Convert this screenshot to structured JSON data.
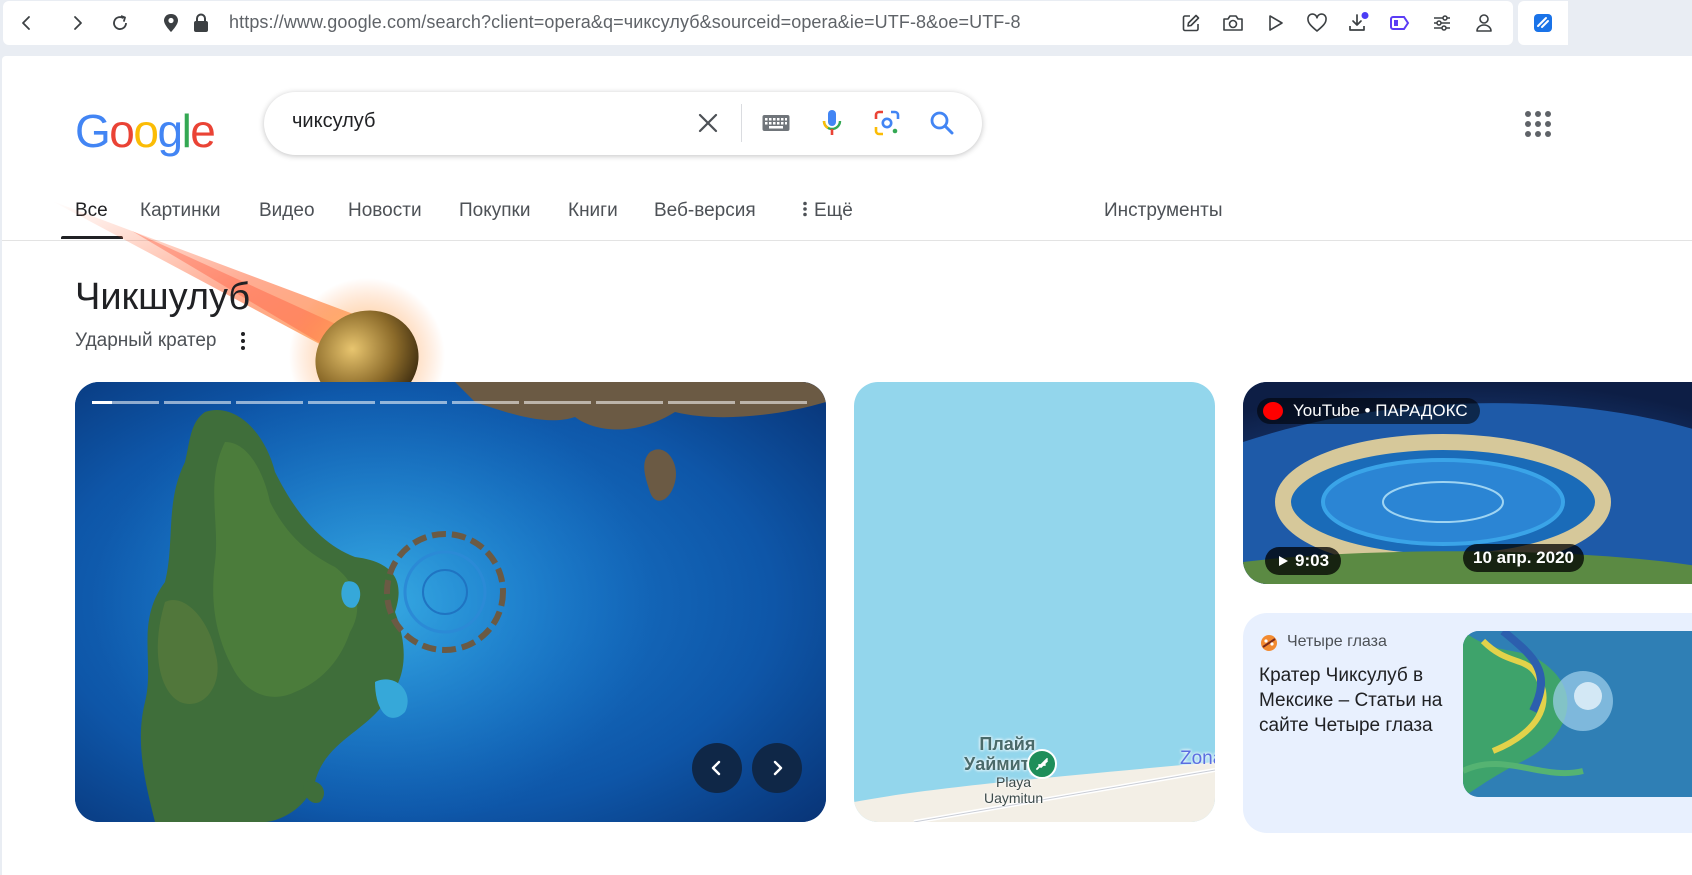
{
  "browser": {
    "url": "https://www.google.com/search?client=opera&q=чиксулуб&sourceid=opera&ie=UTF-8&oe=UTF-8"
  },
  "logo": {
    "letters": [
      "G",
      "o",
      "o",
      "g",
      "l",
      "e"
    ],
    "colors": [
      "#4285F4",
      "#EA4335",
      "#FBBC05",
      "#4285F4",
      "#34A853",
      "#EA4335"
    ]
  },
  "search": {
    "query": "чиксулуб"
  },
  "tabs": {
    "all": "Все",
    "images": "Картинки",
    "video": "Видео",
    "news": "Новости",
    "shopping": "Покупки",
    "books": "Книги",
    "web": "Веб-версия",
    "more": "Ещё",
    "tools": "Инструменты"
  },
  "knowledge_panel": {
    "title": "Чикшулуб",
    "subtitle": "Ударный кратер"
  },
  "map": {
    "place_ru": "Плайя Уаймитун",
    "place_ru_line1": "Плайя",
    "place_ru_line2": "Уаймитун",
    "place_es_line1": "Playa",
    "place_es_line2": "Uaymitun",
    "edge_label": "Zona"
  },
  "video": {
    "source": "YouTube • ПАРАДОКС",
    "duration": "9:03",
    "date": "10 апр. 2020"
  },
  "article": {
    "source": "Четыре глаза",
    "title": "Кратер Чиксулуб в Мексике – Статьи на сайте Четыре глаза"
  },
  "colors": {
    "accent_blue": "#4285F4",
    "text_primary": "#202124",
    "text_secondary": "#4d5156",
    "download_dot": "#4b3df5"
  }
}
